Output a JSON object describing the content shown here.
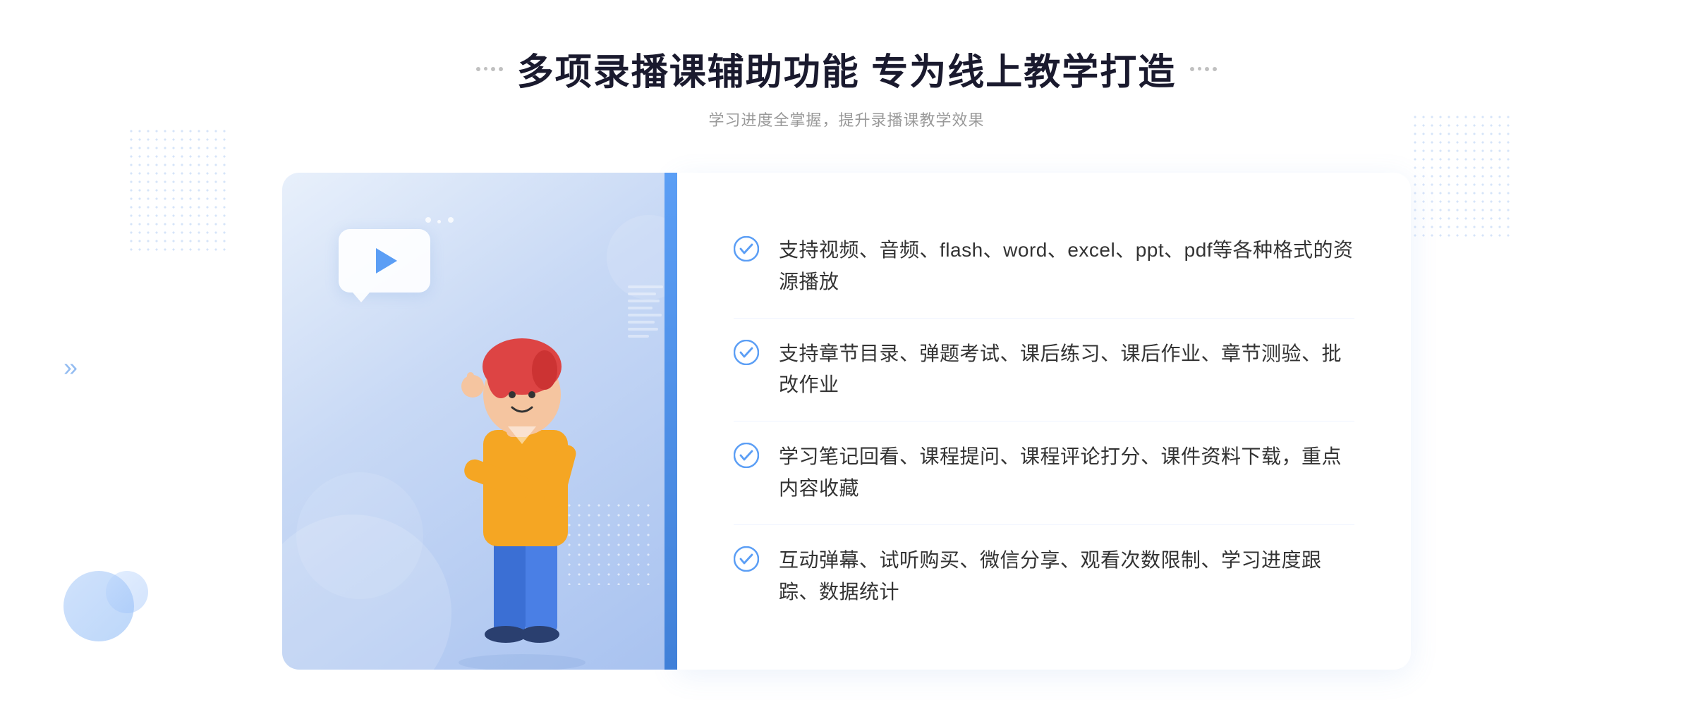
{
  "header": {
    "title": "多项录播课辅助功能 专为线上教学打造",
    "subtitle": "学习进度全掌握，提升录播课教学效果"
  },
  "features": [
    {
      "id": "feature-1",
      "text": "支持视频、音频、flash、word、excel、ppt、pdf等各种格式的资源播放"
    },
    {
      "id": "feature-2",
      "text": "支持章节目录、弹题考试、课后练习、课后作业、章节测验、批改作业"
    },
    {
      "id": "feature-3",
      "text": "学习笔记回看、课程提问、课程评论打分、课件资料下载，重点内容收藏"
    },
    {
      "id": "feature-4",
      "text": "互动弹幕、试听购买、微信分享、观看次数限制、学习进度跟踪、数据统计"
    }
  ],
  "decorations": {
    "chevron": "»",
    "check_color": "#5B9EF5"
  }
}
